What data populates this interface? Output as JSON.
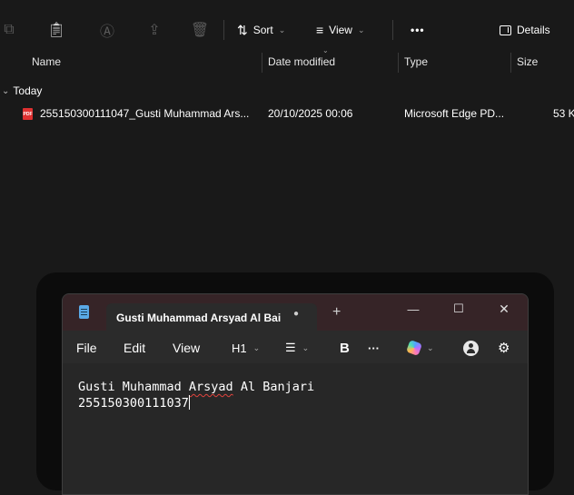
{
  "explorer": {
    "toolbar": {
      "sort_label": "Sort",
      "view_label": "View",
      "more_label": "•••",
      "details_label": "Details"
    },
    "columns": {
      "name": "Name",
      "date": "Date modified",
      "type": "Type",
      "size": "Size"
    },
    "group_label": "Today",
    "file": {
      "icon_text": "PDF",
      "name": "255150300111047_Gusti Muhammad Ars...",
      "date": "20/10/2025 00:06",
      "type": "Microsoft Edge PD...",
      "size": "53 K"
    }
  },
  "notepad": {
    "tab_title": "Gusti Muhammad Arsyad Al Bai",
    "unsaved_dot": "●",
    "new_tab": "+",
    "window_controls": {
      "minimize": "—",
      "maximize": "☐",
      "close": "✕"
    },
    "menu": {
      "file": "File",
      "edit": "Edit",
      "view": "View"
    },
    "tools": {
      "heading": "H1",
      "list": "☰",
      "bold": "B",
      "more": "···"
    },
    "content": {
      "line1_a": "Gusti Muhammad ",
      "line1_b": "Arsyad",
      "line1_c": " Al Banjari",
      "line2": "255150300111037"
    }
  }
}
